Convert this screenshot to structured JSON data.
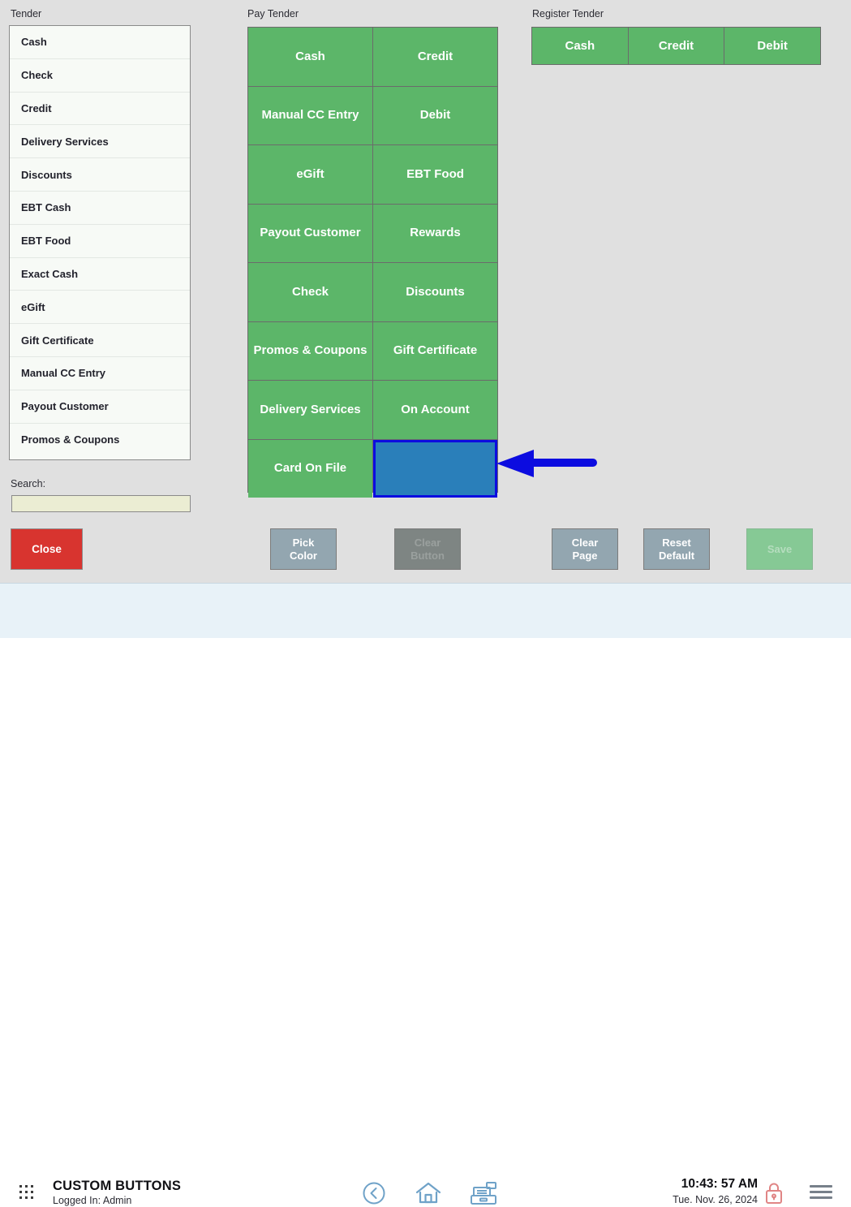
{
  "sections": {
    "tender_label": "Tender",
    "pay_tender_label": "Pay Tender",
    "register_tender_label": "Register Tender"
  },
  "tender_list": [
    {
      "label": "Cash"
    },
    {
      "label": "Check"
    },
    {
      "label": "Credit"
    },
    {
      "label": "Delivery Services"
    },
    {
      "label": "Discounts"
    },
    {
      "label": "EBT Cash"
    },
    {
      "label": "EBT Food"
    },
    {
      "label": "Exact Cash"
    },
    {
      "label": "eGift"
    },
    {
      "label": "Gift Certificate"
    },
    {
      "label": "Manual CC Entry"
    },
    {
      "label": "Payout Customer"
    },
    {
      "label": "Promos & Coupons"
    }
  ],
  "search": {
    "label": "Search:",
    "value": "",
    "placeholder": ""
  },
  "pay_tender_buttons": [
    {
      "label": "Cash",
      "state": "filled"
    },
    {
      "label": "Credit",
      "state": "filled"
    },
    {
      "label": "Manual CC Entry",
      "state": "filled"
    },
    {
      "label": "Debit",
      "state": "filled"
    },
    {
      "label": "eGift",
      "state": "filled"
    },
    {
      "label": "EBT Food",
      "state": "filled"
    },
    {
      "label": "Payout Customer",
      "state": "filled"
    },
    {
      "label": "Rewards",
      "state": "filled"
    },
    {
      "label": "Check",
      "state": "filled"
    },
    {
      "label": "Discounts",
      "state": "filled"
    },
    {
      "label": "Promos & Coupons",
      "state": "filled"
    },
    {
      "label": "Gift Certificate",
      "state": "filled"
    },
    {
      "label": "Delivery Services",
      "state": "filled"
    },
    {
      "label": "On Account",
      "state": "filled"
    },
    {
      "label": "Card On File",
      "state": "filled"
    },
    {
      "label": "",
      "state": "selected-empty"
    }
  ],
  "register_tender_buttons": [
    {
      "label": "Cash"
    },
    {
      "label": "Credit"
    },
    {
      "label": "Debit"
    }
  ],
  "actions": {
    "close": "Close",
    "pick_color": "Pick\nColor",
    "pick_color_line1": "Pick",
    "pick_color_line2": "Color",
    "clear_button_line1": "Clear",
    "clear_button_line2": "Button",
    "clear_page_line1": "Clear",
    "clear_page_line2": "Page",
    "reset_default_line1": "Reset",
    "reset_default_line2": "Default",
    "save": "Save"
  },
  "status_bar": {
    "title": "CUSTOM BUTTONS",
    "logged_in": "Logged In:  Admin",
    "time": "10:43: 57 AM",
    "date": "Tue. Nov. 26, 2024",
    "icons": {
      "app_grid": "grid-dots-icon",
      "back": "back-circle-icon",
      "home": "home-icon",
      "register": "cash-register-icon",
      "lock": "lock-icon",
      "menu": "hamburger-menu-icon"
    }
  },
  "annotation": {
    "type": "arrow",
    "direction": "left",
    "color": "#0c0ce0",
    "points_to": "selected-empty-pay-tender-cell"
  },
  "colors": {
    "tender_button_green": "#5cb669",
    "selected_blue_fill": "#2a7fba",
    "selected_blue_border": "#0c0ce0",
    "close_red": "#d8342f",
    "action_enabled_gray": "#93a6b0",
    "action_disabled_gray": "#7e8583",
    "save_disabled_green": "#86c995",
    "page_background": "#e0e0e0",
    "status_bar_background": "#e8f2f8",
    "search_field": "#ebedd3"
  }
}
